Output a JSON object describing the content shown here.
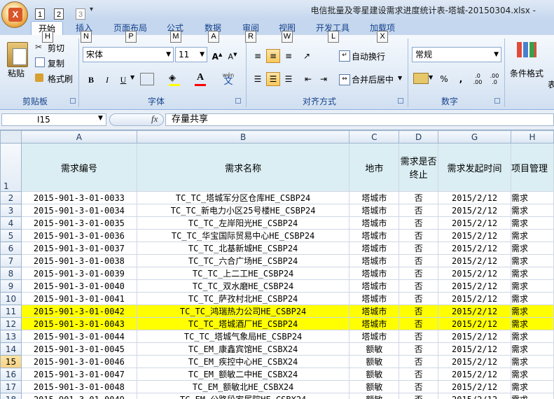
{
  "window": {
    "title": "电信批量及零星建设需求进度统计表-塔城-20150304.xlsx - ",
    "quick_access_keys": [
      "1",
      "2",
      "3"
    ],
    "office_button_icon": "excel-logo-icon"
  },
  "tabs": [
    {
      "label": "开始",
      "key": "H",
      "active": true
    },
    {
      "label": "插入",
      "key": "N"
    },
    {
      "label": "页面布局",
      "key": "P"
    },
    {
      "label": "公式",
      "key": "M"
    },
    {
      "label": "数据",
      "key": "A"
    },
    {
      "label": "审阅",
      "key": "R"
    },
    {
      "label": "视图",
      "key": "W"
    },
    {
      "label": "开发工具",
      "key": "L"
    },
    {
      "label": "加载项",
      "key": "X"
    }
  ],
  "ribbon": {
    "clipboard": {
      "group": "剪贴板",
      "paste": "粘贴",
      "cut": "剪切",
      "copy": "复制",
      "format_painter": "格式刷"
    },
    "font": {
      "group": "字体",
      "font_name": "宋体",
      "font_size": "11",
      "bold": "B",
      "italic": "I",
      "underline": "U",
      "wen": "wén",
      "wen_char": "文"
    },
    "alignment": {
      "group": "对齐方式",
      "wrap": "自动换行",
      "merge": "合并后居中"
    },
    "number": {
      "group": "数字",
      "format": "常规",
      "percent": "%",
      "comma": ","
    },
    "styles": {
      "cond_format": "条件格式",
      "extra": "表"
    }
  },
  "formula_bar": {
    "cell": "I15",
    "fx": "fx",
    "formula": "存量共享"
  },
  "sheet": {
    "columns": [
      "A",
      "B",
      "C",
      "D",
      "G",
      "H"
    ],
    "header_row": {
      "num": "1",
      "cells": [
        "需求编号",
        "需求名称",
        "地市",
        "需求是否终止",
        "需求发起时间",
        "项目管理"
      ]
    },
    "rows": [
      {
        "num": "2",
        "cells": [
          "2015-901-3-01-0033",
          "TC_TC_塔城军分区仓库HE_CSBP24",
          "塔城市",
          "否",
          "2015/2/12",
          "需求"
        ]
      },
      {
        "num": "3",
        "cells": [
          "2015-901-3-01-0034",
          "TC_TC_新电力小区25号楼HE_CSBP24",
          "塔城市",
          "否",
          "2015/2/12",
          "需求"
        ]
      },
      {
        "num": "4",
        "cells": [
          "2015-901-3-01-0035",
          "TC_TC_左岸阳光HE_CSBP24",
          "塔城市",
          "否",
          "2015/2/12",
          "需求"
        ]
      },
      {
        "num": "5",
        "cells": [
          "2015-901-3-01-0036",
          "TC_TC_华宝国际贸易中心HE_CSBP24",
          "塔城市",
          "否",
          "2015/2/12",
          "需求"
        ]
      },
      {
        "num": "6",
        "cells": [
          "2015-901-3-01-0037",
          "TC_TC_北基新城HE_CSBP24",
          "塔城市",
          "否",
          "2015/2/12",
          "需求"
        ]
      },
      {
        "num": "7",
        "cells": [
          "2015-901-3-01-0038",
          "TC_TC_六合广场HE_CSBP24",
          "塔城市",
          "否",
          "2015/2/12",
          "需求"
        ]
      },
      {
        "num": "8",
        "cells": [
          "2015-901-3-01-0039",
          "TC_TC_上二工HE_CSBP24",
          "塔城市",
          "否",
          "2015/2/12",
          "需求"
        ]
      },
      {
        "num": "9",
        "cells": [
          "2015-901-3-01-0040",
          "TC_TC_双水磨HE_CSBP24",
          "塔城市",
          "否",
          "2015/2/12",
          "需求"
        ]
      },
      {
        "num": "10",
        "cells": [
          "2015-901-3-01-0041",
          "TC_TC_萨孜村北HE_CSBP24",
          "塔城市",
          "否",
          "2015/2/12",
          "需求"
        ]
      },
      {
        "num": "11",
        "cells": [
          "2015-901-3-01-0042",
          "TC_TC_鸿瑞热力公司HE_CSBP24",
          "塔城市",
          "否",
          "2015/2/12",
          "需求"
        ],
        "highlight": true
      },
      {
        "num": "12",
        "cells": [
          "2015-901-3-01-0043",
          "TC_TC_塔城酒厂HE_CSBP24",
          "塔城市",
          "否",
          "2015/2/12",
          "需求"
        ],
        "highlight": true
      },
      {
        "num": "13",
        "cells": [
          "2015-901-3-01-0044",
          "TC_TC_塔城气象局HE_CSBP24",
          "塔城市",
          "否",
          "2015/2/12",
          "需求"
        ]
      },
      {
        "num": "14",
        "cells": [
          "2015-901-3-01-0045",
          "TC_EM_康鑫宾馆HE_CSBX24",
          "额敏",
          "否",
          "2015/2/12",
          "需求"
        ]
      },
      {
        "num": "15",
        "cells": [
          "2015-901-3-01-0046",
          "TC_EM_疾控中心HE_CSBX24",
          "额敏",
          "否",
          "2015/2/12",
          "需求"
        ],
        "selected": true
      },
      {
        "num": "16",
        "cells": [
          "2015-901-3-01-0047",
          "TC_EM_额敏二中HE_CSBX24",
          "额敏",
          "否",
          "2015/2/12",
          "需求"
        ]
      },
      {
        "num": "17",
        "cells": [
          "2015-901-3-01-0048",
          "TC_EM_额敏北HE_CSBX24",
          "额敏",
          "否",
          "2015/2/12",
          "需求"
        ]
      },
      {
        "num": "18",
        "cells": [
          "2015-901-3-01-0049",
          "TC_EM_公路段家属院HE_CSBX24",
          "额敏",
          "否",
          "2015/2/12",
          "需求"
        ]
      },
      {
        "num": "",
        "cells": [
          "",
          "",
          "",
          "",
          "",
          ""
        ]
      }
    ]
  },
  "colors": {
    "highlight": "#ffff00",
    "header_fill": "#dbeef3",
    "accent": "#15428b"
  }
}
